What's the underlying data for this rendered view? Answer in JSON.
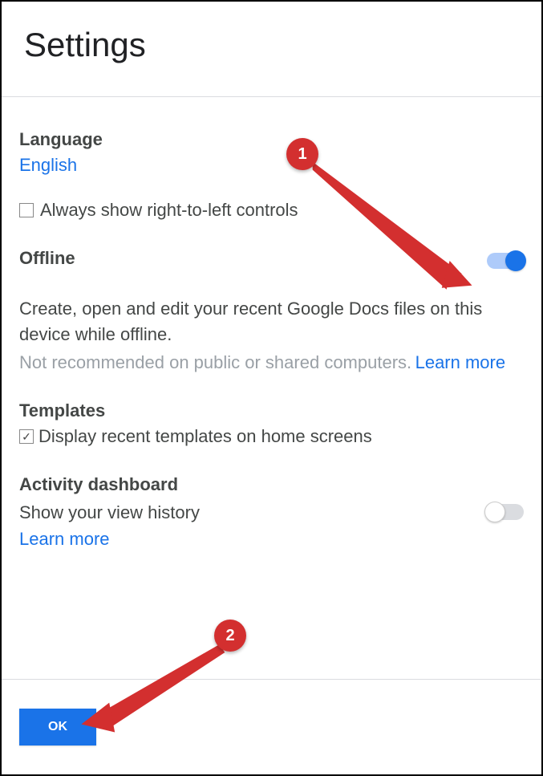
{
  "header": {
    "title": "Settings"
  },
  "language": {
    "heading": "Language",
    "value": "English",
    "rtl_label": "Always show right-to-left controls",
    "rtl_checked": false
  },
  "offline": {
    "heading": "Offline",
    "enabled": true,
    "description": "Create, open and edit your recent Google Docs files on this device while offline.",
    "note": "Not recommended on public or shared computers.",
    "learn_more": "Learn more"
  },
  "templates": {
    "heading": "Templates",
    "checkbox_label": "Display recent templates on home screens",
    "checked": true
  },
  "activity": {
    "heading": "Activity dashboard",
    "label": "Show your view history",
    "learn_more": "Learn more",
    "enabled": false
  },
  "footer": {
    "ok": "OK"
  },
  "annotations": {
    "badge1": "1",
    "badge2": "2"
  }
}
